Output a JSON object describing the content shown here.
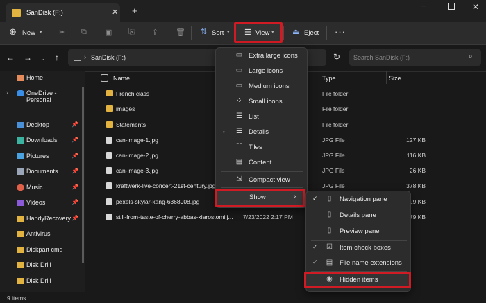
{
  "window": {
    "tab_title": "SanDisk (F:)",
    "tab_close": "✕",
    "new_tab": "+",
    "minimize": "─",
    "close": "✕"
  },
  "toolbar": {
    "new_label": "New",
    "sort_label": "Sort",
    "view_label": "View",
    "eject_label": "Eject",
    "more": "···"
  },
  "address": {
    "crumb": "SanDisk (F:)",
    "search_placeholder": "Search SanDisk (F:)"
  },
  "sidebar": {
    "items": [
      {
        "label": "Home",
        "color": "#e58a5a"
      },
      {
        "label": "OneDrive - Personal",
        "color": "#3a8ee6"
      },
      {
        "label": "Desktop",
        "color": "#4a90d9"
      },
      {
        "label": "Downloads",
        "color": "#3bb3a0"
      },
      {
        "label": "Pictures",
        "color": "#4aa3e0"
      },
      {
        "label": "Documents",
        "color": "#9aa6b8"
      },
      {
        "label": "Music",
        "color": "#e0604a"
      },
      {
        "label": "Videos",
        "color": "#8a5ad8"
      },
      {
        "label": "HandyRecovery",
        "color": "#e3b341"
      },
      {
        "label": "Antivirus",
        "color": "#e3b341"
      },
      {
        "label": "Diskpart cmd",
        "color": "#e3b341"
      },
      {
        "label": "Disk Drill",
        "color": "#e3b341"
      },
      {
        "label": "Disk Drill",
        "color": "#e3b341"
      }
    ]
  },
  "columns": {
    "name": "Name",
    "type": "Type",
    "size": "Size"
  },
  "files": [
    {
      "name": "French class",
      "date": "",
      "type": "File folder",
      "size": ""
    },
    {
      "name": "images",
      "date": "",
      "type": "File folder",
      "size": ""
    },
    {
      "name": "Statements",
      "date": "",
      "type": "File folder",
      "size": ""
    },
    {
      "name": "can-image-1.jpg",
      "date": "",
      "type": "JPG File",
      "size": "127 KB"
    },
    {
      "name": "can-image-2.jpg",
      "date": "",
      "type": "JPG File",
      "size": "116 KB"
    },
    {
      "name": "can-image-3.jpg",
      "date": "",
      "type": "JPG File",
      "size": "26 KB"
    },
    {
      "name": "kraftwerk-live-concert-21st-century.jpg",
      "date": "",
      "type": "JPG File",
      "size": "378 KB"
    },
    {
      "name": "pexels-skylar-kang-6368908.jpg",
      "date": "",
      "type": "",
      "size": "29 KB"
    },
    {
      "name": "still-from-taste-of-cherry-abbas-kiarostomi.j...",
      "date": "7/23/2022 2:17 PM",
      "type": "",
      "size": "79 KB"
    }
  ],
  "status": {
    "count": "9 items"
  },
  "view_menu": {
    "items": [
      {
        "label": "Extra large icons",
        "icon": "▭"
      },
      {
        "label": "Large icons",
        "icon": "▭"
      },
      {
        "label": "Medium icons",
        "icon": "▭"
      },
      {
        "label": "Small icons",
        "icon": "⁘"
      },
      {
        "label": "List",
        "icon": "☰"
      },
      {
        "label": "Details",
        "icon": "☰"
      },
      {
        "label": "Tiles",
        "icon": "☷"
      },
      {
        "label": "Content",
        "icon": "▤"
      },
      {
        "label": "Compact view",
        "icon": "⇲"
      }
    ],
    "selected_bullet": "•",
    "show_label": "Show",
    "show_arrow": "›"
  },
  "show_menu": {
    "items": [
      {
        "label": "Navigation pane",
        "checked": "✓",
        "icon": "▯"
      },
      {
        "label": "Details pane",
        "checked": "",
        "icon": "▯"
      },
      {
        "label": "Preview pane",
        "checked": "",
        "icon": "▯"
      },
      {
        "label": "Item check boxes",
        "checked": "✓",
        "icon": "☑"
      },
      {
        "label": "File name extensions",
        "checked": "✓",
        "icon": "▤"
      },
      {
        "label": "Hidden items",
        "checked": "",
        "icon": "◉"
      }
    ]
  }
}
